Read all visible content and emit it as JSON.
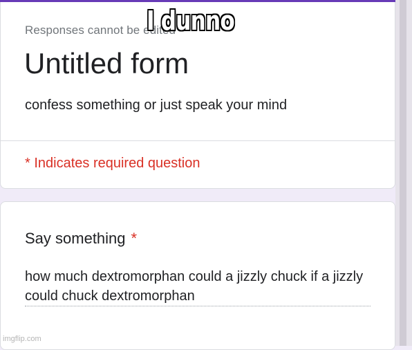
{
  "form": {
    "responses_notice": "Responses cannot be edited",
    "title": "Untitled form",
    "description": "confess something or just speak your mind",
    "required_note": "* Indicates required question",
    "accent_color": "#673ab7",
    "required_color": "#d93025"
  },
  "question": {
    "title": "Say something",
    "required_marker": "*",
    "answer": "how much dextromorphan could a jizzly chuck if a jizzly could chuck dextromorphan"
  },
  "overlay": {
    "caption": "I dunno",
    "watermark": "imgflip.com"
  }
}
